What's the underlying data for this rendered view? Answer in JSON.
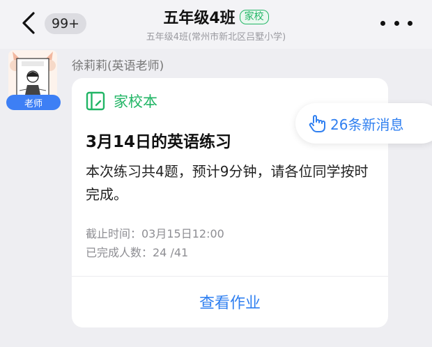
{
  "header": {
    "unread_count": "99+",
    "title": "五年级4班",
    "tag": "家校",
    "subtitle": "五年级4班(常州市新北区吕墅小学)"
  },
  "message": {
    "sender": "徐莉莉(英语老师)",
    "role_badge": "老师",
    "card": {
      "type_label": "家校本",
      "title": "3月14日的英语练习",
      "description": "本次练习共4题，预计9分钟，请各位同学按时完成。",
      "deadline": "截止时间：03月15日12:00",
      "completed": "已完成人数：24 /41",
      "action": "查看作业"
    }
  },
  "new_messages": {
    "label": "26条新消息"
  },
  "colors": {
    "accent_green": "#21b565",
    "accent_blue": "#2f7ff0",
    "badge_blue": "#3d7ff5"
  }
}
